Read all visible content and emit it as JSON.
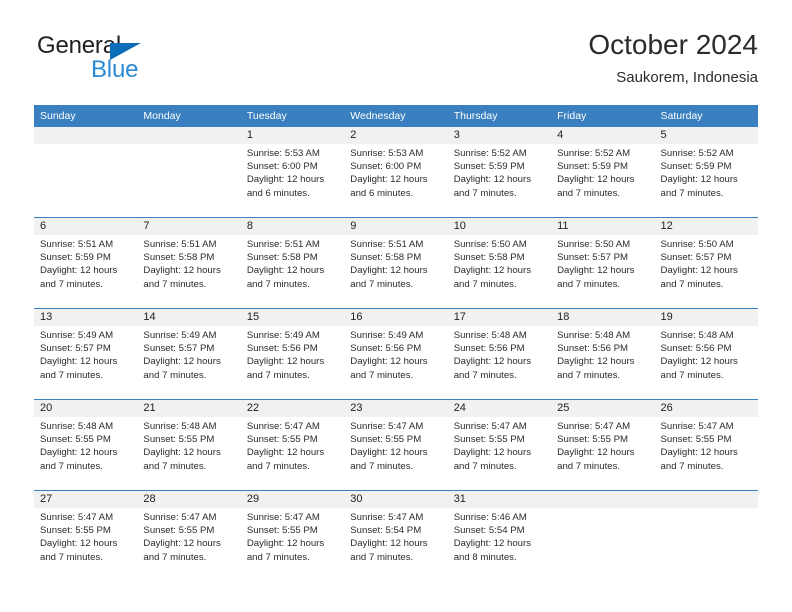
{
  "brand": {
    "name_primary": "General",
    "name_secondary": "Blue",
    "triangle_color": "#0b6cb7",
    "accent_color": "#2b8ad4"
  },
  "header": {
    "title": "October 2024",
    "subtitle": "Saukorem, Indonesia"
  },
  "calendar": {
    "header_bg": "#3a7fbf",
    "daynum_bg": "#f1f1f1",
    "weekdays": [
      "Sunday",
      "Monday",
      "Tuesday",
      "Wednesday",
      "Thursday",
      "Friday",
      "Saturday"
    ],
    "weeks": [
      [
        {
          "day": "",
          "sunrise": "",
          "sunset": "",
          "daylight1": "",
          "daylight2": "",
          "empty": true
        },
        {
          "day": "",
          "sunrise": "",
          "sunset": "",
          "daylight1": "",
          "daylight2": "",
          "empty": true
        },
        {
          "day": "1",
          "sunrise": "Sunrise: 5:53 AM",
          "sunset": "Sunset: 6:00 PM",
          "daylight1": "Daylight: 12 hours",
          "daylight2": "and 6 minutes."
        },
        {
          "day": "2",
          "sunrise": "Sunrise: 5:53 AM",
          "sunset": "Sunset: 6:00 PM",
          "daylight1": "Daylight: 12 hours",
          "daylight2": "and 6 minutes."
        },
        {
          "day": "3",
          "sunrise": "Sunrise: 5:52 AM",
          "sunset": "Sunset: 5:59 PM",
          "daylight1": "Daylight: 12 hours",
          "daylight2": "and 7 minutes."
        },
        {
          "day": "4",
          "sunrise": "Sunrise: 5:52 AM",
          "sunset": "Sunset: 5:59 PM",
          "daylight1": "Daylight: 12 hours",
          "daylight2": "and 7 minutes."
        },
        {
          "day": "5",
          "sunrise": "Sunrise: 5:52 AM",
          "sunset": "Sunset: 5:59 PM",
          "daylight1": "Daylight: 12 hours",
          "daylight2": "and 7 minutes."
        }
      ],
      [
        {
          "day": "6",
          "sunrise": "Sunrise: 5:51 AM",
          "sunset": "Sunset: 5:59 PM",
          "daylight1": "Daylight: 12 hours",
          "daylight2": "and 7 minutes."
        },
        {
          "day": "7",
          "sunrise": "Sunrise: 5:51 AM",
          "sunset": "Sunset: 5:58 PM",
          "daylight1": "Daylight: 12 hours",
          "daylight2": "and 7 minutes."
        },
        {
          "day": "8",
          "sunrise": "Sunrise: 5:51 AM",
          "sunset": "Sunset: 5:58 PM",
          "daylight1": "Daylight: 12 hours",
          "daylight2": "and 7 minutes."
        },
        {
          "day": "9",
          "sunrise": "Sunrise: 5:51 AM",
          "sunset": "Sunset: 5:58 PM",
          "daylight1": "Daylight: 12 hours",
          "daylight2": "and 7 minutes."
        },
        {
          "day": "10",
          "sunrise": "Sunrise: 5:50 AM",
          "sunset": "Sunset: 5:58 PM",
          "daylight1": "Daylight: 12 hours",
          "daylight2": "and 7 minutes."
        },
        {
          "day": "11",
          "sunrise": "Sunrise: 5:50 AM",
          "sunset": "Sunset: 5:57 PM",
          "daylight1": "Daylight: 12 hours",
          "daylight2": "and 7 minutes."
        },
        {
          "day": "12",
          "sunrise": "Sunrise: 5:50 AM",
          "sunset": "Sunset: 5:57 PM",
          "daylight1": "Daylight: 12 hours",
          "daylight2": "and 7 minutes."
        }
      ],
      [
        {
          "day": "13",
          "sunrise": "Sunrise: 5:49 AM",
          "sunset": "Sunset: 5:57 PM",
          "daylight1": "Daylight: 12 hours",
          "daylight2": "and 7 minutes."
        },
        {
          "day": "14",
          "sunrise": "Sunrise: 5:49 AM",
          "sunset": "Sunset: 5:57 PM",
          "daylight1": "Daylight: 12 hours",
          "daylight2": "and 7 minutes."
        },
        {
          "day": "15",
          "sunrise": "Sunrise: 5:49 AM",
          "sunset": "Sunset: 5:56 PM",
          "daylight1": "Daylight: 12 hours",
          "daylight2": "and 7 minutes."
        },
        {
          "day": "16",
          "sunrise": "Sunrise: 5:49 AM",
          "sunset": "Sunset: 5:56 PM",
          "daylight1": "Daylight: 12 hours",
          "daylight2": "and 7 minutes."
        },
        {
          "day": "17",
          "sunrise": "Sunrise: 5:48 AM",
          "sunset": "Sunset: 5:56 PM",
          "daylight1": "Daylight: 12 hours",
          "daylight2": "and 7 minutes."
        },
        {
          "day": "18",
          "sunrise": "Sunrise: 5:48 AM",
          "sunset": "Sunset: 5:56 PM",
          "daylight1": "Daylight: 12 hours",
          "daylight2": "and 7 minutes."
        },
        {
          "day": "19",
          "sunrise": "Sunrise: 5:48 AM",
          "sunset": "Sunset: 5:56 PM",
          "daylight1": "Daylight: 12 hours",
          "daylight2": "and 7 minutes."
        }
      ],
      [
        {
          "day": "20",
          "sunrise": "Sunrise: 5:48 AM",
          "sunset": "Sunset: 5:55 PM",
          "daylight1": "Daylight: 12 hours",
          "daylight2": "and 7 minutes."
        },
        {
          "day": "21",
          "sunrise": "Sunrise: 5:48 AM",
          "sunset": "Sunset: 5:55 PM",
          "daylight1": "Daylight: 12 hours",
          "daylight2": "and 7 minutes."
        },
        {
          "day": "22",
          "sunrise": "Sunrise: 5:47 AM",
          "sunset": "Sunset: 5:55 PM",
          "daylight1": "Daylight: 12 hours",
          "daylight2": "and 7 minutes."
        },
        {
          "day": "23",
          "sunrise": "Sunrise: 5:47 AM",
          "sunset": "Sunset: 5:55 PM",
          "daylight1": "Daylight: 12 hours",
          "daylight2": "and 7 minutes."
        },
        {
          "day": "24",
          "sunrise": "Sunrise: 5:47 AM",
          "sunset": "Sunset: 5:55 PM",
          "daylight1": "Daylight: 12 hours",
          "daylight2": "and 7 minutes."
        },
        {
          "day": "25",
          "sunrise": "Sunrise: 5:47 AM",
          "sunset": "Sunset: 5:55 PM",
          "daylight1": "Daylight: 12 hours",
          "daylight2": "and 7 minutes."
        },
        {
          "day": "26",
          "sunrise": "Sunrise: 5:47 AM",
          "sunset": "Sunset: 5:55 PM",
          "daylight1": "Daylight: 12 hours",
          "daylight2": "and 7 minutes."
        }
      ],
      [
        {
          "day": "27",
          "sunrise": "Sunrise: 5:47 AM",
          "sunset": "Sunset: 5:55 PM",
          "daylight1": "Daylight: 12 hours",
          "daylight2": "and 7 minutes."
        },
        {
          "day": "28",
          "sunrise": "Sunrise: 5:47 AM",
          "sunset": "Sunset: 5:55 PM",
          "daylight1": "Daylight: 12 hours",
          "daylight2": "and 7 minutes."
        },
        {
          "day": "29",
          "sunrise": "Sunrise: 5:47 AM",
          "sunset": "Sunset: 5:55 PM",
          "daylight1": "Daylight: 12 hours",
          "daylight2": "and 7 minutes."
        },
        {
          "day": "30",
          "sunrise": "Sunrise: 5:47 AM",
          "sunset": "Sunset: 5:54 PM",
          "daylight1": "Daylight: 12 hours",
          "daylight2": "and 7 minutes."
        },
        {
          "day": "31",
          "sunrise": "Sunrise: 5:46 AM",
          "sunset": "Sunset: 5:54 PM",
          "daylight1": "Daylight: 12 hours",
          "daylight2": "and 8 minutes."
        },
        {
          "day": "",
          "sunrise": "",
          "sunset": "",
          "daylight1": "",
          "daylight2": "",
          "empty": true
        },
        {
          "day": "",
          "sunrise": "",
          "sunset": "",
          "daylight1": "",
          "daylight2": "",
          "empty": true
        }
      ]
    ]
  }
}
